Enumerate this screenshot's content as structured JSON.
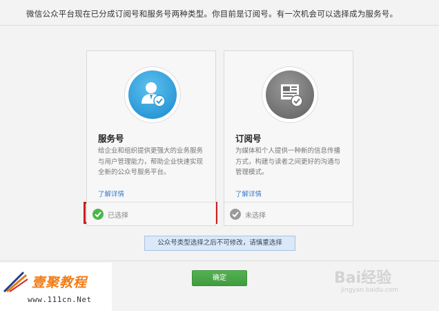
{
  "intro_text": "微信公众平台现在已分成订阅号和服务号两种类型。你目前是订阅号。有一次机会可以选择成为服务号。",
  "cards": {
    "service": {
      "title": "服务号",
      "description": "给企业和组织提供更强大的业务服务与用户管理能力，帮助企业快速实现全新的公众号服务平台。",
      "learn_more": "了解详情",
      "status": "已选择",
      "icon": "person-check-icon",
      "selected": true
    },
    "subscription": {
      "title": "订阅号",
      "description": "为媒体和个人提供一种新的信息传播方式，构建与读者之间更好的沟通与管理模式。",
      "learn_more": "了解详情",
      "status": "未选择",
      "icon": "document-check-icon",
      "selected": false
    }
  },
  "notice": "公众号类型选择之后不可修改，请慎重选择",
  "confirm_label": "确定",
  "colors": {
    "service_blue": "#2d9ad8",
    "subscription_gray": "#707070",
    "selected_green": "#4db74b",
    "highlight_red": "#cc1d1d",
    "confirm_green": "#3f9b3d"
  },
  "watermarks": {
    "left_brand": "壹聚教程",
    "left_url": "www.111cn.Net",
    "right_brand": "Bai经验",
    "right_url": "jingyan.baidu.com"
  }
}
